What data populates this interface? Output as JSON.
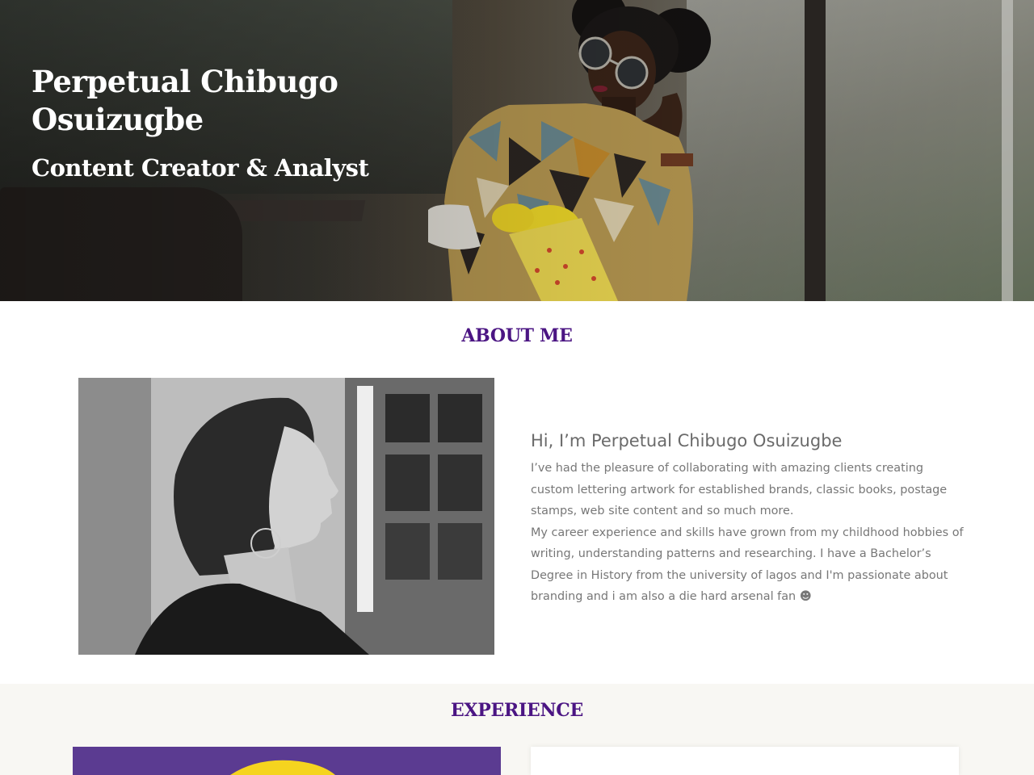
{
  "hero": {
    "name": "Perpetual Chibugo Osuizugbe",
    "role": "Content Creator & Analyst"
  },
  "about": {
    "title": "ABOUT ME",
    "heading": "Hi, I’m Perpetual Chibugo Osuizugbe",
    "paragraph_1": "I’ve had the pleasure of collaborating with amazing clients creating custom lettering artwork for established brands, classic books, postage stamps, web site content and so much more.",
    "paragraph_2": "My career experience and skills have grown from my childhood hobbies of writing, understanding patterns and researching. I have a Bachelor’s Degree in History from the university of lagos and I'm passionate about branding and i am also a die hard arsenal fan ☻"
  },
  "experience": {
    "title": "EXPERIENCE"
  },
  "colors": {
    "accent": "#4b1583",
    "experience_bg": "#f8f7f3",
    "experience_image_bg": "#5b3b91",
    "experience_image_shape": "#f5d41f"
  }
}
